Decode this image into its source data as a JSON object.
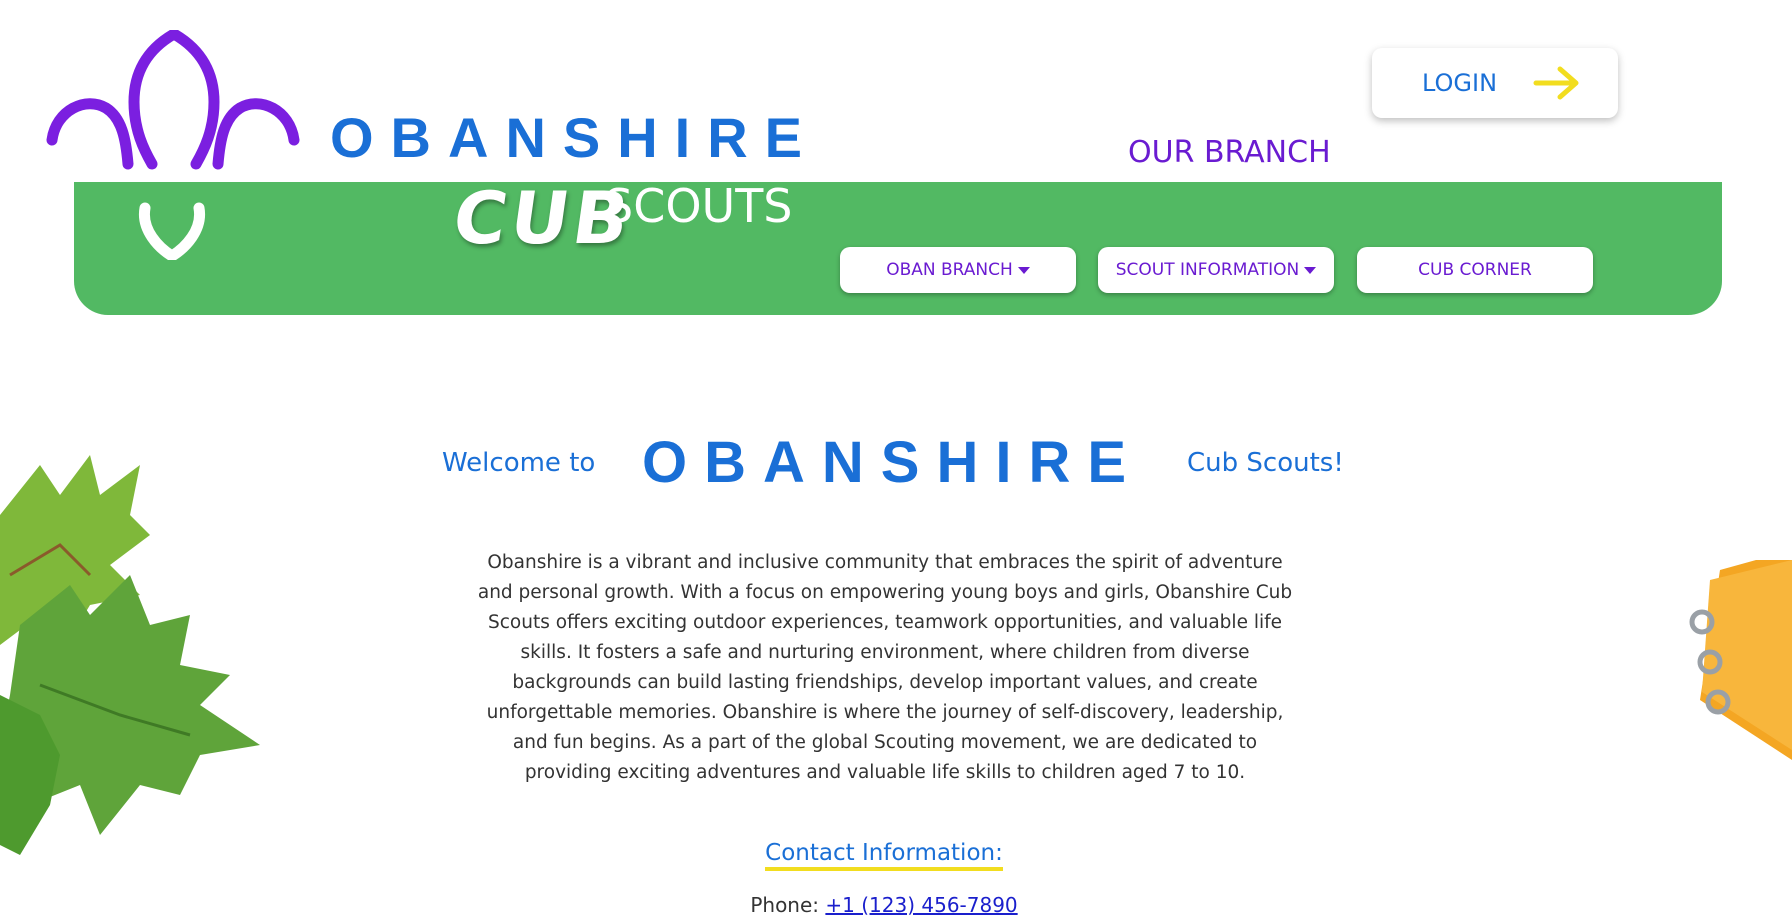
{
  "brand": {
    "logo_word": "OBANSHIRE",
    "cub": "CUB",
    "scouts": "SCOUTS"
  },
  "login": {
    "label": "LOGIN"
  },
  "branch": {
    "title": "OUR BRANCH"
  },
  "nav": {
    "items": [
      {
        "label": "OBAN BRANCH",
        "dropdown": true
      },
      {
        "label": "SCOUT INFORMATION",
        "dropdown": true
      },
      {
        "label": "CUB CORNER",
        "dropdown": false
      }
    ]
  },
  "welcome": {
    "prefix": "Welcome to",
    "brand": "OBANSHIRE",
    "suffix": "Cub Scouts!"
  },
  "about": {
    "text": "Obanshire is a vibrant and inclusive community that embraces the spirit of adventure and personal growth. With a focus on empowering young boys and girls, Obanshire Cub Scouts offers exciting outdoor experiences, teamwork opportunities, and valuable life skills. It fosters a safe and nurturing environment, where children from diverse backgrounds can build lasting friendships, develop important values, and create unforgettable memories. Obanshire is where the journey of self-discovery, leadership, and fun begins. As a part of the global Scouting movement, we are dedicated to providing exciting adventures and valuable life skills to children aged 7 to 10."
  },
  "contact": {
    "heading": "Contact Information:",
    "phone_label": "Phone:",
    "phone_value": "+1 (123) 456-7890"
  },
  "colors": {
    "brand_blue": "#1a6fd6",
    "purple": "#6a1bd1",
    "green": "#52b963",
    "yellow": "#f2dd1f"
  },
  "icons": [
    "fleur-de-lis-icon",
    "arrow-right-icon",
    "caret-down-icon"
  ]
}
